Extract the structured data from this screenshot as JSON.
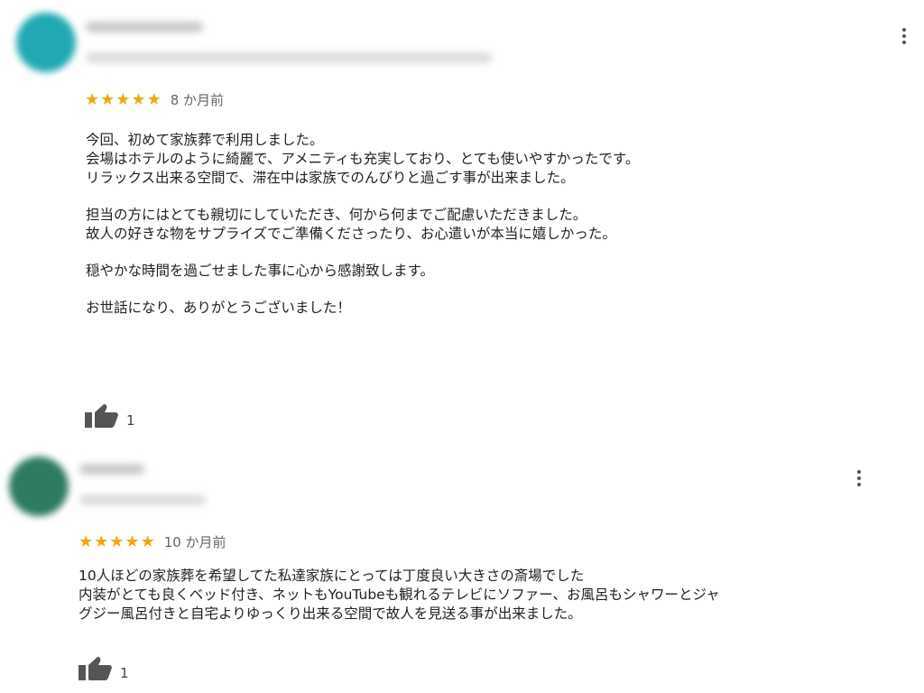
{
  "colors": {
    "star": "#f2a60c",
    "text": "#222222",
    "muted": "#666666",
    "icon": "#555555"
  },
  "reviews": [
    {
      "rating": 5,
      "date": "8 か月前",
      "lines": [
        "今回、初めて家族葬で利用しました。",
        "会場はホテルのように綺麗で、アメニティも充実しており、とても使いやすかったです。",
        "リラックス出来る空間で、滞在中は家族でのんびりと過ごす事が出来ました。",
        "",
        "担当の方にはとても親切にしていただき、何から何までご配慮いただきました。",
        "故人の好きな物をサプライズでご準備くださったり、お心遣いが本当に嬉しかった。",
        "",
        "穏やかな時間を過ごせました事に心から感謝致します。",
        "",
        "お世話になり、ありがとうございました！"
      ],
      "likes": "1",
      "avatar_color": "#21a8b3"
    },
    {
      "rating": 5,
      "date": "10 か月前",
      "lines": [
        "10人ほどの家族葬を希望してた私達家族にとっては丁度良い大きさの斎場でした",
        "内装がとても良くベッド付き、ネットもYouTubeも観れるテレビにソファー、お風呂もシャワーとジャ",
        "グジー風呂付きと自宅よりゆっくり出来る空間で故人を見送る事が出来ました。"
      ],
      "likes": "1",
      "avatar_color": "#2e7a62"
    }
  ]
}
